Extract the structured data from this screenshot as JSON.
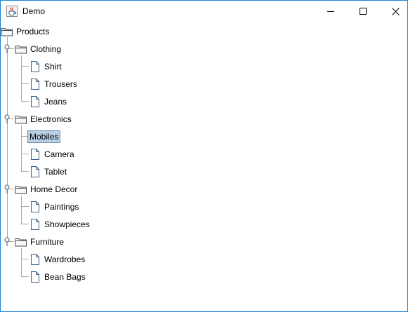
{
  "window": {
    "title": "Demo",
    "icon": "java-cup-icon",
    "controls": [
      "minimize-icon",
      "maximize-icon",
      "close-icon"
    ],
    "border_color": "#1883d7"
  },
  "tree": {
    "root": {
      "label": "Products",
      "icon": "folder-open-icon",
      "children": [
        {
          "label": "Clothing",
          "icon": "folder-open-icon",
          "expanded": true,
          "children": [
            {
              "label": "Shirt",
              "icon": "document-icon"
            },
            {
              "label": "Trousers",
              "icon": "document-icon"
            },
            {
              "label": "Jeans",
              "icon": "document-icon"
            }
          ]
        },
        {
          "label": "Electronics",
          "icon": "folder-open-icon",
          "expanded": true,
          "children": [
            {
              "label": "Mobiles",
              "icon": "document-icon",
              "selected": true
            },
            {
              "label": "Camera",
              "icon": "document-icon"
            },
            {
              "label": "Tablet",
              "icon": "document-icon"
            }
          ]
        },
        {
          "label": "Home Decor",
          "icon": "folder-open-icon",
          "expanded": true,
          "children": [
            {
              "label": "Paintings",
              "icon": "document-icon"
            },
            {
              "label": "Showpieces",
              "icon": "document-icon"
            }
          ]
        },
        {
          "label": "Furniture",
          "icon": "folder-open-icon",
          "expanded": true,
          "children": [
            {
              "label": "Wardrobes",
              "icon": "document-icon"
            },
            {
              "label": "Bean Bags",
              "icon": "document-icon"
            }
          ]
        }
      ]
    },
    "selection_color": "#b8cfe5",
    "selection_border": "#6d8dad"
  }
}
